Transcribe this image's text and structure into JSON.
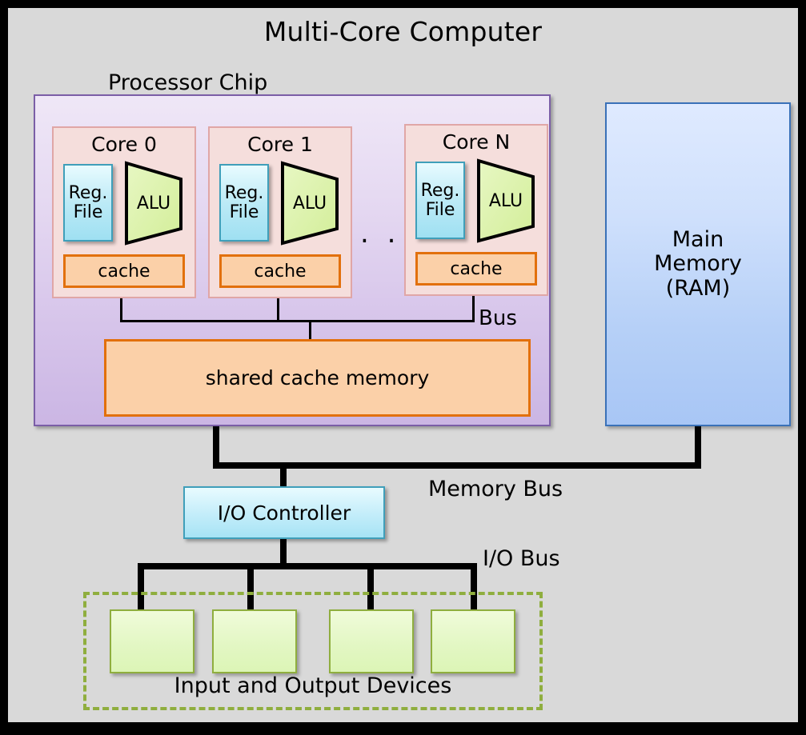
{
  "title": "Multi-Core Computer",
  "colors": {
    "background": "#d9d9d9",
    "frame": "#000000",
    "chip_border": "#7b5ea7",
    "core_border": "#e0a6a6",
    "core_fill": "#f5dedc",
    "regfile_border": "#3f9fba",
    "alu_fill": "#dff2b0",
    "cache_border": "#e2700c",
    "cache_fill": "#fbd0a8",
    "memory_border": "#3a71b8",
    "device_border": "#8fae3e",
    "wire": "#000000"
  },
  "processor_chip": {
    "label": "Processor Chip",
    "bus_label": "Bus",
    "shared_cache_label": "shared cache memory",
    "ellipsis": ". . .",
    "cores": [
      {
        "label": "Core 0",
        "regfile_line1": "Reg.",
        "regfile_line2": "File",
        "alu": "ALU",
        "cache": "cache"
      },
      {
        "label": "Core 1",
        "regfile_line1": "Reg.",
        "regfile_line2": "File",
        "alu": "ALU",
        "cache": "cache"
      },
      {
        "label": "Core N",
        "regfile_line1": "Reg.",
        "regfile_line2": "File",
        "alu": "ALU",
        "cache": "cache"
      }
    ]
  },
  "main_memory": {
    "line1": "Main",
    "line2": "Memory",
    "line3": "(RAM)"
  },
  "memory_bus_label": "Memory Bus",
  "io_controller": {
    "label": "I/O Controller"
  },
  "io_bus_label": "I/O Bus",
  "io_devices": {
    "label": "Input and Output Devices",
    "count": 4
  }
}
